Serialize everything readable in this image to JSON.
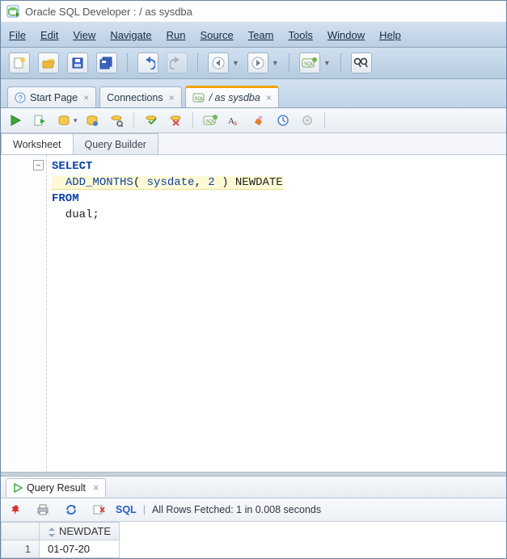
{
  "window": {
    "title": "Oracle SQL Developer : / as sysdba"
  },
  "menu": {
    "file": "File",
    "edit": "Edit",
    "view": "View",
    "navigate": "Navigate",
    "run": "Run",
    "source": "Source",
    "team": "Team",
    "tools": "Tools",
    "window": "Window",
    "help": "Help"
  },
  "tabs": {
    "start": "Start Page",
    "connections": "Connections",
    "active": "/ as sysdba"
  },
  "wstabs": {
    "worksheet": "Worksheet",
    "querybuilder": "Query Builder"
  },
  "sql": {
    "line1_kw": "SELECT",
    "line2_fn": "ADD_MONTHS",
    "line2_open": "( ",
    "line2_arg1": "sysdate",
    "line2_comma": ", ",
    "line2_arg2": "2",
    "line2_close": " ) ",
    "line2_alias": "NEWDATE",
    "line3_kw": "FROM",
    "line4": "  dual;"
  },
  "result": {
    "tab": "Query Result",
    "sql_label": "SQL",
    "status_sep": "|",
    "status": "All Rows Fetched: 1 in 0.008 seconds",
    "col1": "NEWDATE",
    "row1_num": "1",
    "row1_val": "01-07-20"
  }
}
